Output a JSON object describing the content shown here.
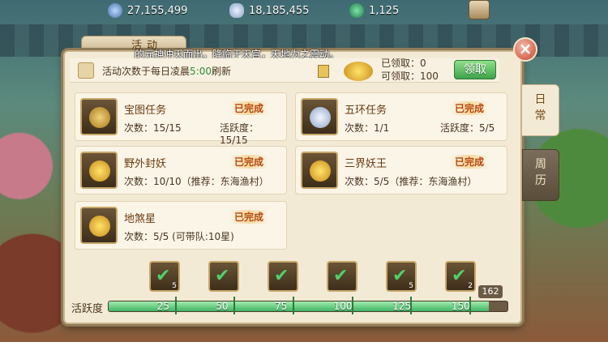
{
  "currency": {
    "silver": "27,155,499",
    "gold": "18,185,455",
    "jade": "1,125"
  },
  "panel": {
    "title": "活动",
    "marquee": "的元神冲天而出，降临于天宫，天地为之震动。",
    "info_prefix": "活动次数于每日凌晨",
    "info_time": "5:00",
    "info_suffix": "刷新",
    "claimed": "已领取：0",
    "claimable": "可领取：100",
    "claim_button": "领取",
    "close": "×"
  },
  "tabs": {
    "daily": "日\n常",
    "weekly": "周\n历"
  },
  "tasks": [
    {
      "name": "宝图任务",
      "status": "已完成",
      "line1": "次数：15/15",
      "line2": "活跃度：15/15",
      "icon": "treasure-map-icon"
    },
    {
      "name": "五环任务",
      "status": "已完成",
      "line1": "次数：1/1",
      "line2": "活跃度：5/5",
      "icon": "silver-ingot-icon"
    },
    {
      "name": "野外封妖",
      "status": "已完成",
      "line1": "次数：10/10（推荐：东海渔村）",
      "line2": "",
      "icon": "exp-gourd-icon"
    },
    {
      "name": "三界妖王",
      "status": "已完成",
      "line1": "次数：5/5（推荐：东海渔村）",
      "line2": "",
      "icon": "exp-gourd-icon"
    },
    {
      "name": "地煞星",
      "status": "已完成",
      "line1": "次数：5/5 (可带队:10星)",
      "line2": "",
      "icon": "exp-gourd-icon"
    }
  ],
  "rewards": [
    {
      "count": "5"
    },
    {
      "count": ""
    },
    {
      "count": ""
    },
    {
      "count": ""
    },
    {
      "count": "5"
    },
    {
      "count": "2"
    }
  ],
  "activity": {
    "label": "活跃度",
    "current": "162",
    "max": 170,
    "milestones": [
      "25",
      "50",
      "75",
      "100",
      "125",
      "150"
    ],
    "fill_color": "#3fb463"
  }
}
